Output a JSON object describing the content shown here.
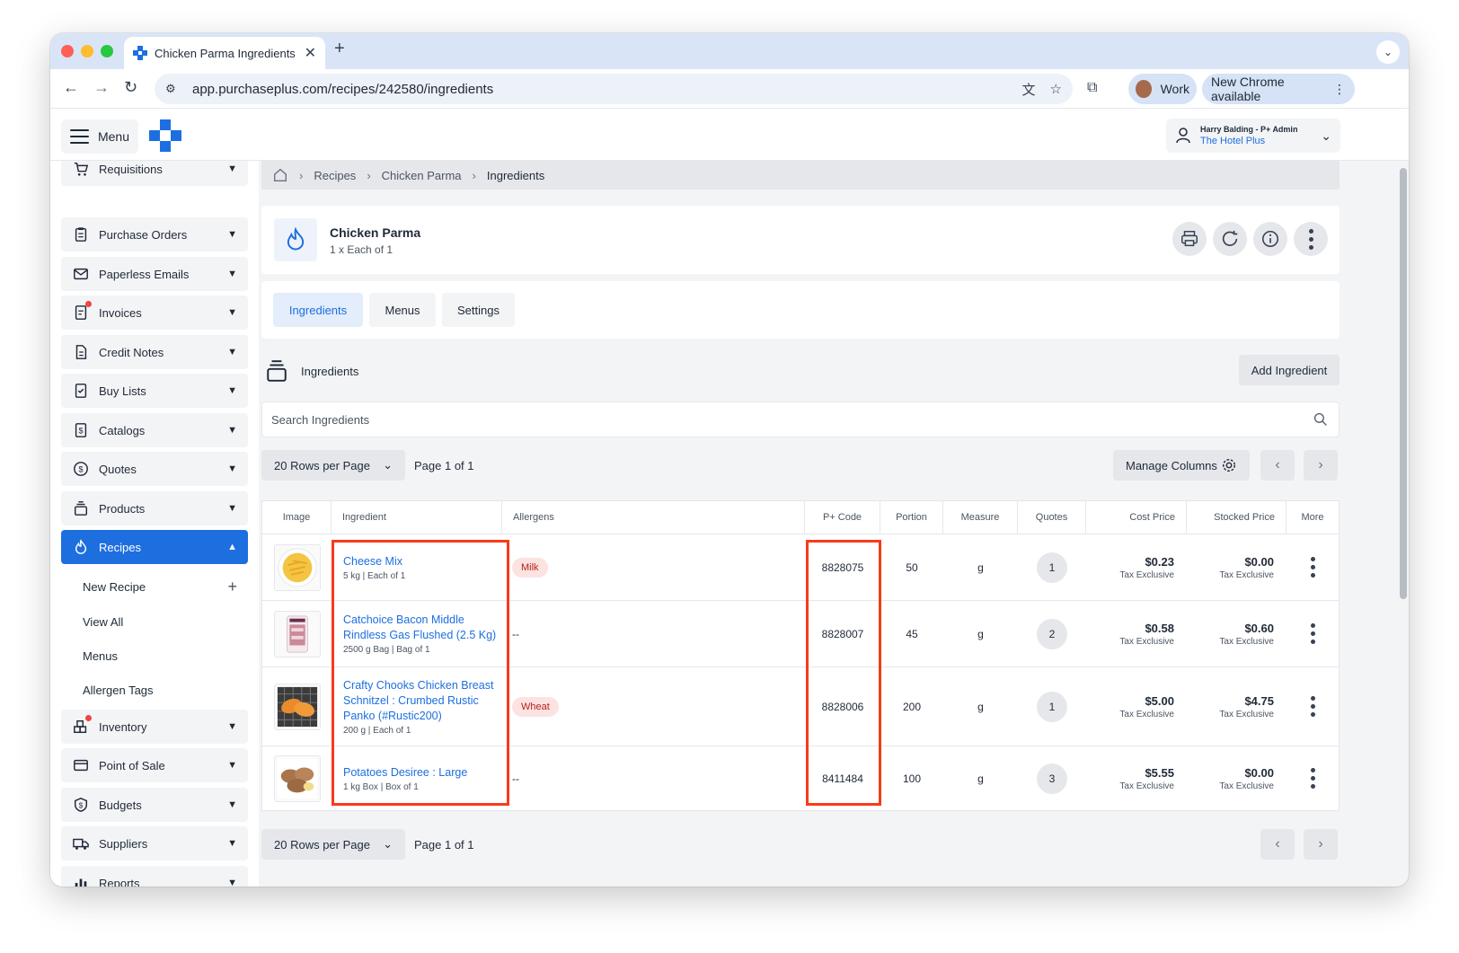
{
  "browser": {
    "tab_title": "Chicken Parma Ingredients",
    "tab_close": "✕",
    "new_tab": "+",
    "url": "app.purchaseplus.com/recipes/242580/ingredients",
    "profile_label": "Work",
    "update_label": "New Chrome available"
  },
  "header": {
    "menu_label": "Menu",
    "user_name": "Harry Balding - P+ Admin",
    "org_name": "The Hotel Plus"
  },
  "sidebar": {
    "items": [
      {
        "label": "Requisitions",
        "icon": "cart-icon"
      },
      {
        "label": "Purchase Orders",
        "icon": "clipboard-icon"
      },
      {
        "label": "Paperless Emails",
        "icon": "envelope-icon"
      },
      {
        "label": "Invoices",
        "icon": "invoice-icon"
      },
      {
        "label": "Credit Notes",
        "icon": "document-icon"
      },
      {
        "label": "Buy Lists",
        "icon": "checklist-icon"
      },
      {
        "label": "Catalogs",
        "icon": "catalog-icon"
      },
      {
        "label": "Quotes",
        "icon": "dollar-circle-icon"
      },
      {
        "label": "Products",
        "icon": "stack-icon"
      },
      {
        "label": "Recipes",
        "icon": "flame-icon"
      },
      {
        "label": "Inventory",
        "icon": "boxes-icon"
      },
      {
        "label": "Point of Sale",
        "icon": "credit-card-icon"
      },
      {
        "label": "Budgets",
        "icon": "shield-dollar-icon"
      },
      {
        "label": "Suppliers",
        "icon": "truck-icon"
      },
      {
        "label": "Reports",
        "icon": "bar-chart-icon"
      }
    ],
    "recipes_sub": [
      "New Recipe",
      "View All",
      "Menus",
      "Allergen Tags"
    ],
    "new_recipe_plus": "+"
  },
  "breadcrumb": [
    "Recipes",
    "Chicken Parma",
    "Ingredients"
  ],
  "recipe": {
    "title": "Chicken Parma",
    "subtitle": "1 x Each of 1"
  },
  "tabs": [
    "Ingredients",
    "Menus",
    "Settings"
  ],
  "section": {
    "title": "Ingredients",
    "add_label": "Add Ingredient"
  },
  "search": {
    "placeholder": "Search Ingredients"
  },
  "pagination": {
    "rows_label": "20 Rows per Page",
    "page_label": "Page 1 of 1",
    "manage_columns": "Manage Columns"
  },
  "table": {
    "columns": [
      "Image",
      "Ingredient",
      "Allergens",
      "P+ Code",
      "Portion",
      "Measure",
      "Quotes",
      "Cost Price",
      "Stocked Price",
      "More"
    ],
    "rows": [
      {
        "name": "Cheese Mix",
        "pack": "5 kg | Each of 1",
        "allergen": "Milk",
        "code": "8828075",
        "portion": "50",
        "measure": "g",
        "quotes": "1",
        "cost": "$0.23",
        "cost_note": "Tax Exclusive",
        "stocked": "$0.00",
        "stocked_note": "Tax Exclusive"
      },
      {
        "name": "Catchoice Bacon Middle Rindless Gas Flushed (2.5 Kg)",
        "pack": "2500 g Bag | Bag of 1",
        "allergen": "--",
        "code": "8828007",
        "portion": "45",
        "measure": "g",
        "quotes": "2",
        "cost": "$0.58",
        "cost_note": "Tax Exclusive",
        "stocked": "$0.60",
        "stocked_note": "Tax Exclusive"
      },
      {
        "name": "Crafty Chooks Chicken Breast Schnitzel : Crumbed Rustic Panko (#Rustic200)",
        "pack": "200 g | Each of 1",
        "allergen": "Wheat",
        "code": "8828006",
        "portion": "200",
        "measure": "g",
        "quotes": "1",
        "cost": "$5.00",
        "cost_note": "Tax Exclusive",
        "stocked": "$4.75",
        "stocked_note": "Tax Exclusive"
      },
      {
        "name": "Potatoes Desiree : Large",
        "pack": "1 kg Box | Box of 1",
        "allergen": "--",
        "code": "8411484",
        "portion": "100",
        "measure": "g",
        "quotes": "3",
        "cost": "$5.55",
        "cost_note": "Tax Exclusive",
        "stocked": "$0.00",
        "stocked_note": "Tax Exclusive"
      }
    ]
  },
  "colors": {
    "accent": "#1d6fe0",
    "highlight": "#f73b1a",
    "allergen_bg": "#fde2e2"
  }
}
